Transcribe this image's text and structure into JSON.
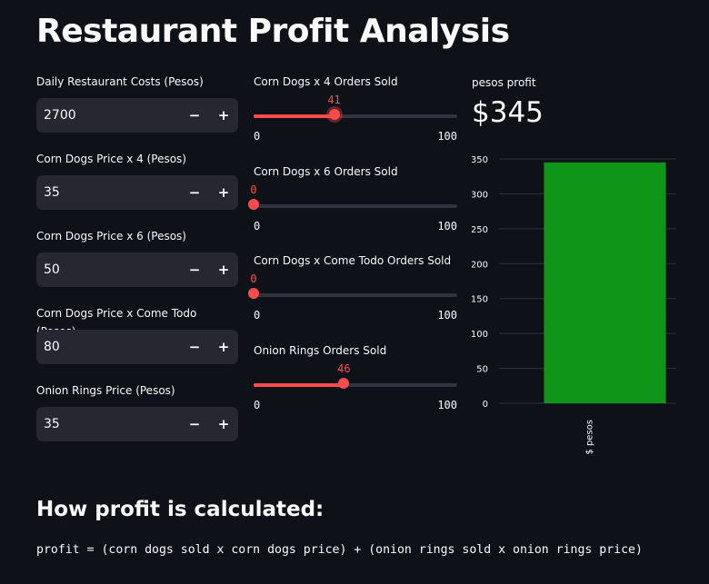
{
  "title": "Restaurant Profit Analysis",
  "inputs": [
    {
      "label": "Daily Restaurant Costs (Pesos)",
      "value": "2700",
      "minus": "−",
      "plus": "+"
    },
    {
      "label": "Corn Dogs Price x 4 (Pesos)",
      "value": "35",
      "minus": "−",
      "plus": "+"
    },
    {
      "label": "Corn Dogs Price x 6 (Pesos)",
      "value": "50",
      "minus": "−",
      "plus": "+"
    },
    {
      "label": "Corn Dogs Price x Come Todo (Pesos)",
      "value": "80",
      "minus": "−",
      "plus": "+"
    },
    {
      "label": "Onion Rings Price (Pesos)",
      "value": "35",
      "minus": "−",
      "plus": "+"
    }
  ],
  "sliders": [
    {
      "label": "Corn Dogs x 4 Orders Sold",
      "value": 41,
      "min": "0",
      "max": "100"
    },
    {
      "label": "Corn Dogs x 6 Orders Sold",
      "value": 0,
      "min": "0",
      "max": "100"
    },
    {
      "label": "Corn Dogs x Come Todo Orders Sold",
      "value": 0,
      "min": "0",
      "max": "100"
    },
    {
      "label": "Onion Rings Orders Sold",
      "value": 46,
      "min": "0",
      "max": "100"
    }
  ],
  "metric": {
    "label": "pesos profit",
    "value": "$345"
  },
  "colors": {
    "accent": "#ff4b4b",
    "bar": "#0f9618",
    "background": "#0e1117",
    "input_bg": "#262730"
  },
  "chart_data": {
    "type": "bar",
    "categories": [
      "$ pesos"
    ],
    "values": [
      345
    ],
    "ylim": [
      0,
      350
    ],
    "yticks": [
      "0",
      "50",
      "100",
      "150",
      "200",
      "250",
      "300",
      "350"
    ],
    "grid": true
  },
  "section": {
    "heading": "How profit is calculated:",
    "formula": "profit = (corn dogs sold x corn dogs price) + (onion rings sold x onion rings price)"
  }
}
